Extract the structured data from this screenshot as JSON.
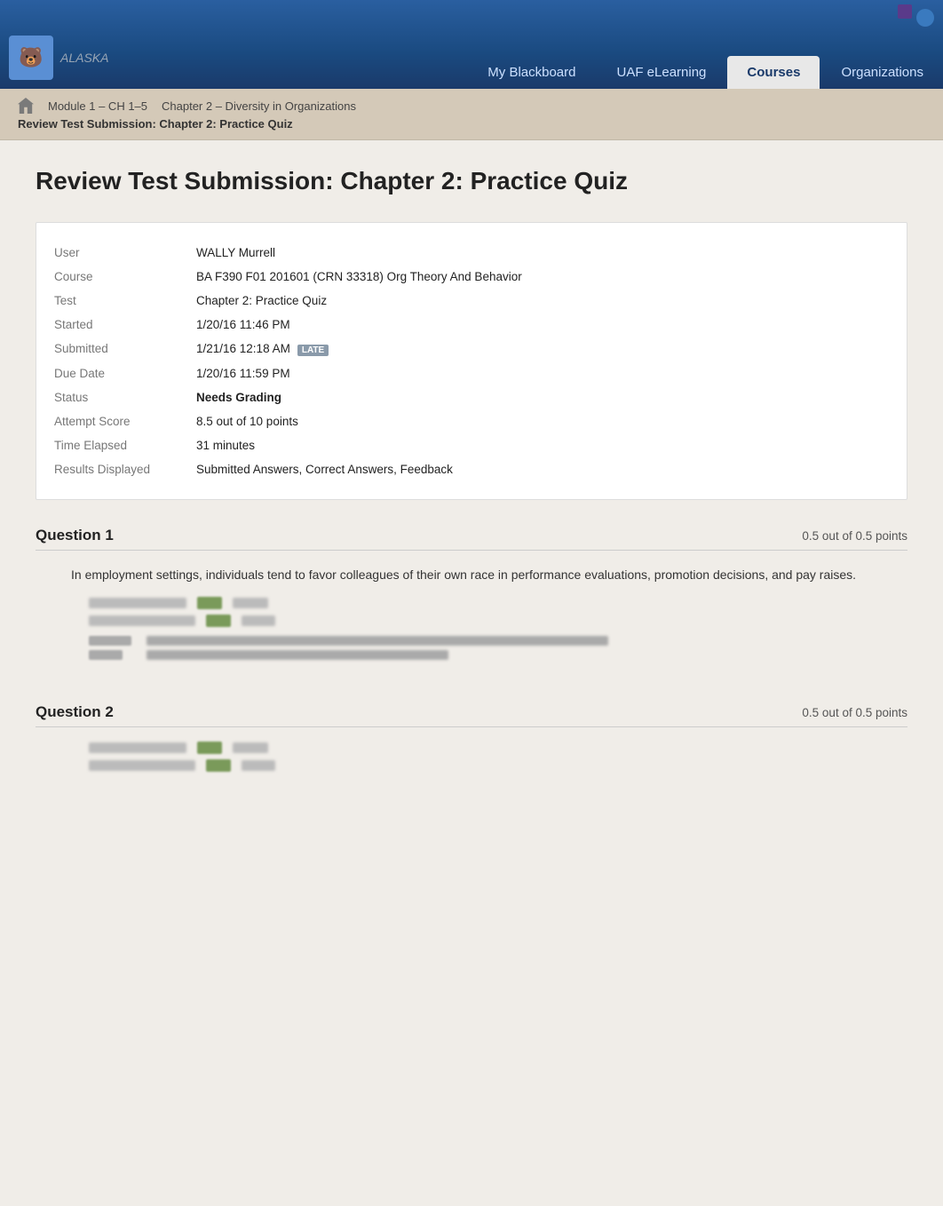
{
  "header": {
    "logo_text": "ALASKA",
    "nav_items": [
      {
        "label": "My Blackboard",
        "active": false
      },
      {
        "label": "UAF eLearning",
        "active": false
      },
      {
        "label": "Courses",
        "active": true
      },
      {
        "label": "Organizations",
        "active": false
      }
    ]
  },
  "breadcrumb": {
    "home_label": "Home",
    "items": [
      {
        "label": "Module 1 – CH 1–5"
      },
      {
        "label": "Chapter 2 – Diversity in Organizations"
      }
    ],
    "current": "Review Test Submission: Chapter 2: Practice Quiz"
  },
  "page_title": "Review Test Submission: Chapter 2: Practice Quiz",
  "info": {
    "rows": [
      {
        "label": "User",
        "value": "WALLY Murrell",
        "bold": false
      },
      {
        "label": "Course",
        "value": "BA F390 F01 201601 (CRN 33318) Org Theory And Behavior",
        "bold": false
      },
      {
        "label": "Test",
        "value": "Chapter 2: Practice Quiz",
        "bold": false
      },
      {
        "label": "Started",
        "value": "1/20/16 11:46 PM",
        "bold": false
      },
      {
        "label": "Submitted",
        "value": "1/21/16 12:18 AM",
        "bold": false,
        "badge": "LATE"
      },
      {
        "label": "Due Date",
        "value": "1/20/16 11:59 PM",
        "bold": false
      },
      {
        "label": "Status",
        "value": "Needs Grading",
        "bold": true
      },
      {
        "label": "Attempt Score",
        "value": "8.5 out of 10 points",
        "bold": false
      },
      {
        "label": "Time Elapsed",
        "value": "31 minutes",
        "bold": false
      },
      {
        "label": "Results Displayed",
        "value": "Submitted Answers, Correct Answers, Feedback",
        "bold": false
      }
    ]
  },
  "questions": [
    {
      "number": "Question 1",
      "points": "0.5 out of 0.5 points",
      "text": "In employment settings, individuals tend to favor colleagues of their own race in performance evaluations, promotion decisions, and pay raises."
    },
    {
      "number": "Question 2",
      "points": "0.5 out of 0.5 points",
      "text": ""
    }
  ]
}
